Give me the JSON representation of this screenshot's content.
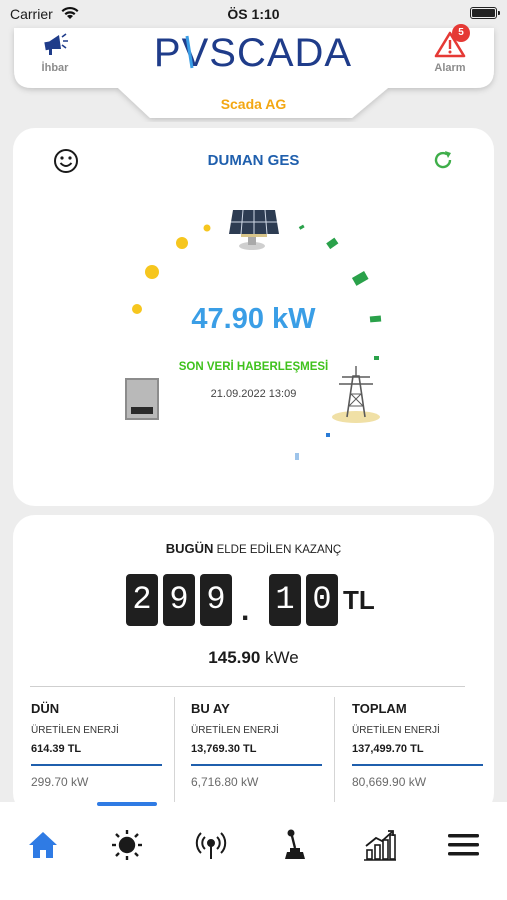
{
  "status_bar": {
    "carrier": "Carrier",
    "time": "ÖS 1:10"
  },
  "header": {
    "left_button": {
      "label": "İhbar",
      "icon": "megaphone-icon"
    },
    "right_button": {
      "label": "Alarm",
      "icon": "warning-triangle-icon",
      "badge": "5"
    },
    "logo_text": "PVSCADA",
    "company": "Scada AG"
  },
  "plant": {
    "title": "DUMAN GES",
    "power": "47.90 kW",
    "comm_label": "SON VERİ HABERLEŞMESİ",
    "comm_time": "21.09.2022 13:09"
  },
  "gain": {
    "title_bold": "BUGÜN",
    "title_rest": " ELDE EDİLEN KAZANÇ",
    "digits": [
      "2",
      "9",
      "9",
      "1",
      "0"
    ],
    "separator": ".",
    "currency": "TL",
    "energy_value": "145.90",
    "energy_unit": " kWe",
    "stats": [
      {
        "title": "DÜN",
        "subtitle": "ÜRETİLEN ENERJİ",
        "money": "614.39 TL",
        "kw": "299.70 kW"
      },
      {
        "title": "BU AY",
        "subtitle": "ÜRETİLEN ENERJİ",
        "money": "13,769.30 TL",
        "kw": "6,716.80 kW"
      },
      {
        "title": "TOPLAM",
        "subtitle": "ÜRETİLEN ENERJİ",
        "money": "137,499.70 TL",
        "kw": "80,669.90 kW"
      }
    ]
  },
  "tabbar": {
    "tabs": [
      {
        "icon": "home-icon",
        "active": true
      },
      {
        "icon": "sun-icon",
        "active": false
      },
      {
        "icon": "antenna-icon",
        "active": false
      },
      {
        "icon": "joystick-icon",
        "active": false
      },
      {
        "icon": "chart-icon",
        "active": false
      },
      {
        "icon": "menu-icon",
        "active": false
      }
    ]
  },
  "colors": {
    "accent_blue": "#2f7be4",
    "title_blue": "#1f5fad",
    "power_blue": "#3a9ee6",
    "green": "#3fc21c",
    "orange": "#f3a712",
    "alarm_red": "#e53935"
  }
}
